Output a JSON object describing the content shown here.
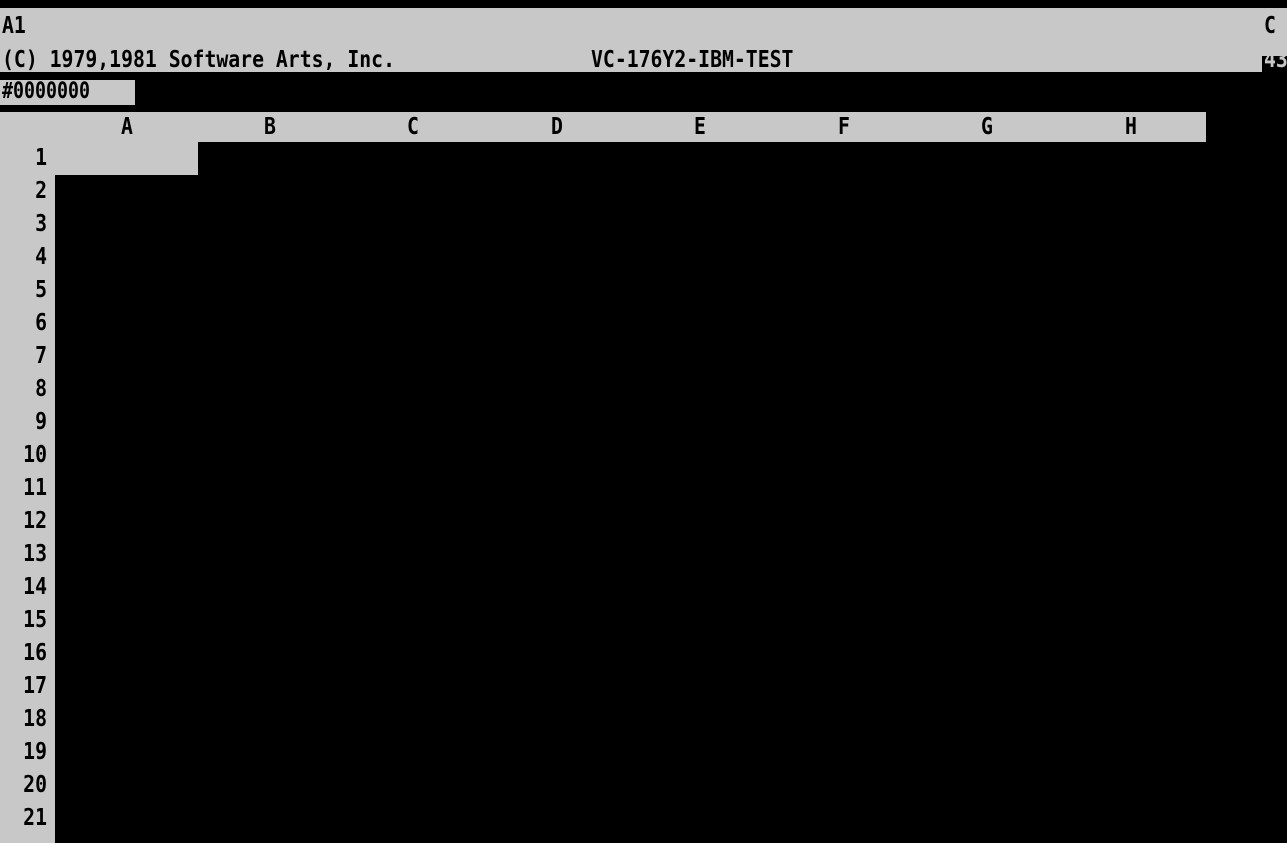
{
  "status": {
    "cell_ref": "A1",
    "copyright": "(C) 1979,1981 Software Arts, Inc.",
    "version": "VC-176Y2-IBM-TEST",
    "mode": "C",
    "memory": "43"
  },
  "entry_line": "#0000000",
  "columns": [
    "A",
    "B",
    "C",
    "D",
    "E",
    "F",
    "G",
    "H"
  ],
  "rows": [
    "1",
    "2",
    "3",
    "4",
    "5",
    "6",
    "7",
    "8",
    "9",
    "10",
    "11",
    "12",
    "13",
    "14",
    "15",
    "16",
    "17",
    "18",
    "19",
    "20",
    "21"
  ],
  "cursor": {
    "cell": "A1"
  },
  "colors": {
    "background": "#000000",
    "foreground": "#c8c8c8"
  }
}
